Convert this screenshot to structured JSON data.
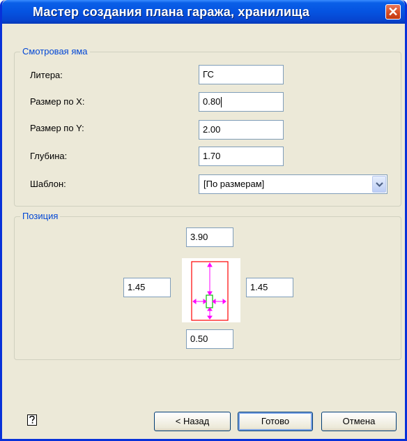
{
  "window": {
    "title": "Мастер создания плана гаража, хранилища",
    "close_glyph": "✕"
  },
  "pit_group": {
    "label": "Смотровая яма",
    "litera": {
      "label": "Литера:",
      "value": "ГС"
    },
    "size_x": {
      "label": "Размер по X:",
      "value": "0.80"
    },
    "size_y": {
      "label": "Размер по Y:",
      "value": "2.00"
    },
    "depth": {
      "label": "Глубина:",
      "value": "1.70"
    },
    "template": {
      "label": "Шаблон:",
      "selected": "[По размерам]"
    }
  },
  "position_group": {
    "label": "Позиция",
    "top": "3.90",
    "left": "1.45",
    "right": "1.45",
    "bottom": "0.50"
  },
  "buttons": {
    "back": "< Назад",
    "finish": "Готово",
    "cancel": "Отмена"
  },
  "colors": {
    "accent": "#0046d5",
    "preview_outline": "#ff0000",
    "preview_arrows": "#ff00ff",
    "preview_pit": "#00c000"
  }
}
